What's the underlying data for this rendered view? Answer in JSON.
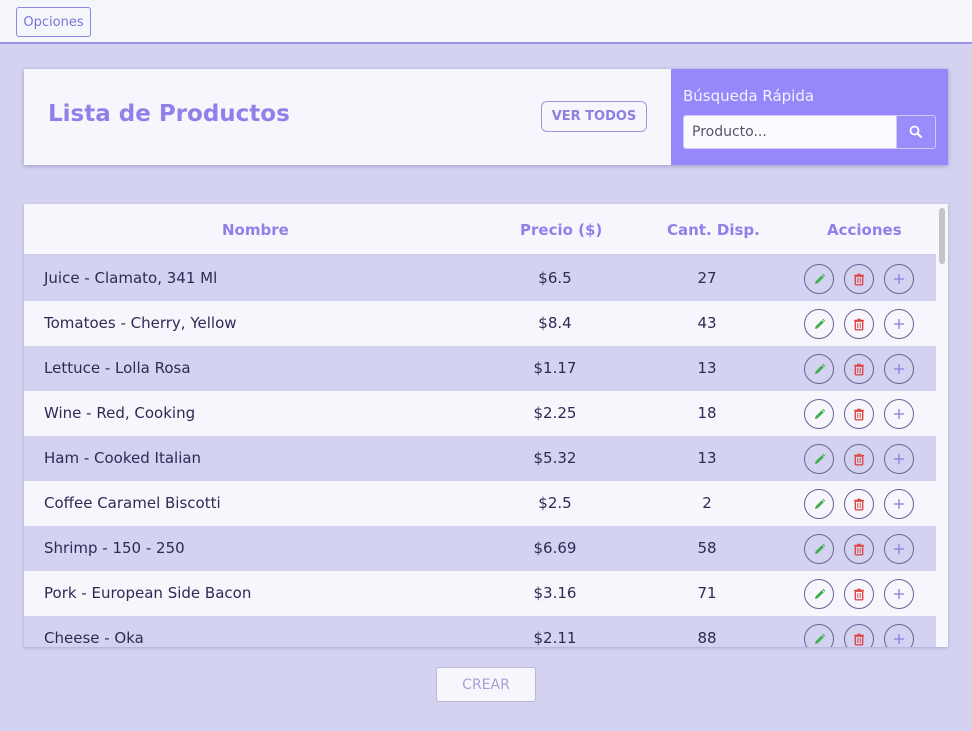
{
  "topbar": {
    "options_label": "Opciones"
  },
  "header": {
    "title": "Lista de Productos",
    "view_all_label": "VER TODOS",
    "quick_search_label": "Búsqueda Rápida",
    "search_placeholder": "Producto..."
  },
  "table": {
    "columns": [
      "Nombre",
      "Precio ($)",
      "Cant. Disp.",
      "Acciones"
    ],
    "rows": [
      {
        "name": "Juice - Clamato, 341 Ml",
        "price": "$6.5",
        "qty": "27"
      },
      {
        "name": "Tomatoes - Cherry, Yellow",
        "price": "$8.4",
        "qty": "43"
      },
      {
        "name": "Lettuce - Lolla Rosa",
        "price": "$1.17",
        "qty": "13"
      },
      {
        "name": "Wine - Red, Cooking",
        "price": "$2.25",
        "qty": "18"
      },
      {
        "name": "Ham - Cooked Italian",
        "price": "$5.32",
        "qty": "13"
      },
      {
        "name": "Coffee Caramel Biscotti",
        "price": "$2.5",
        "qty": "2"
      },
      {
        "name": "Shrimp - 150 - 250",
        "price": "$6.69",
        "qty": "58"
      },
      {
        "name": "Pork - European Side Bacon",
        "price": "$3.16",
        "qty": "71"
      },
      {
        "name": "Cheese - Oka",
        "price": "$2.11",
        "qty": "88"
      }
    ],
    "row_actions": [
      "pencil-icon",
      "trash-icon",
      "plus-icon"
    ]
  },
  "footer": {
    "create_label": "CREAR"
  },
  "colors": {
    "accent": "#9687fb",
    "title": "#8f80ea",
    "edit_icon": "#3fae4a",
    "delete_icon": "#e04848",
    "add_icon": "#8a7fe0"
  }
}
